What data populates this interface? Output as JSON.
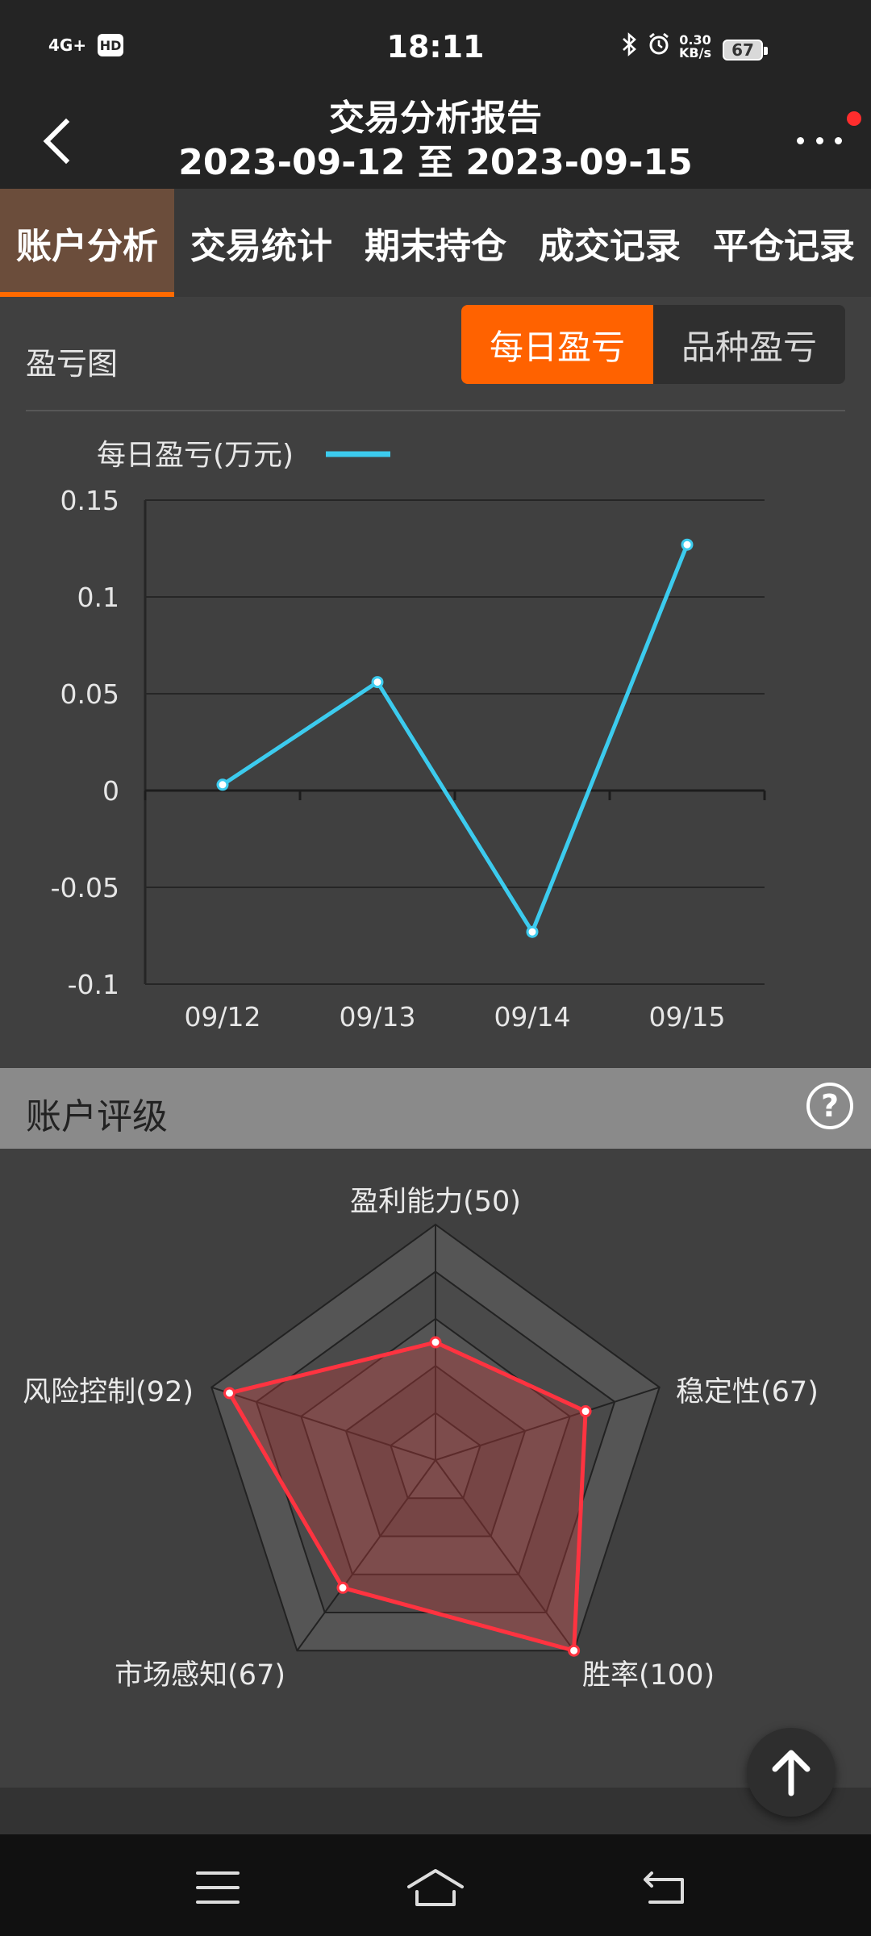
{
  "status_bar": {
    "network": "4G+",
    "hd": "HD",
    "time": "18:11",
    "speed_value": "0.30",
    "speed_unit": "KB/s",
    "battery": "67",
    "icons": [
      "bluetooth-icon",
      "alarm-icon"
    ]
  },
  "header": {
    "title": "交易分析报告",
    "date_range": "2023-09-12 至 2023-09-15"
  },
  "tabs": [
    {
      "label": "账户分析",
      "active": true
    },
    {
      "label": "交易统计",
      "active": false
    },
    {
      "label": "期末持仓",
      "active": false
    },
    {
      "label": "成交记录",
      "active": false
    },
    {
      "label": "平仓记录",
      "active": false
    }
  ],
  "pnl_section": {
    "label": "盈亏图",
    "toggle": [
      {
        "label": "每日盈亏",
        "active": true
      },
      {
        "label": "品种盈亏",
        "active": false
      }
    ]
  },
  "chart_data": {
    "type": "line",
    "categories": [
      "09/12",
      "09/13",
      "09/14",
      "09/15"
    ],
    "series": [
      {
        "name": "每日盈亏(万元)",
        "values": [
          0.003,
          0.056,
          -0.073,
          0.127
        ],
        "color": "#3ccbee"
      }
    ],
    "ylim": [
      -0.1,
      0.15
    ],
    "yticks": [
      {
        "value": 0.15,
        "label": "0.15"
      },
      {
        "value": 0.1,
        "label": "0.1"
      },
      {
        "value": 0.05,
        "label": "0.05"
      },
      {
        "value": 0,
        "label": "0"
      },
      {
        "value": -0.05,
        "label": "-0.05"
      },
      {
        "value": -0.1,
        "label": "-0.1"
      }
    ],
    "grid": true,
    "legend": "top-left"
  },
  "rating": {
    "title": "账户评级",
    "help_icon": "?",
    "axes": [
      {
        "name": "盈利能力",
        "value": 50,
        "label": "盈利能力(50)"
      },
      {
        "name": "稳定性",
        "value": 67,
        "label": "稳定性(67)"
      },
      {
        "name": "胜率",
        "value": 100,
        "label": "胜率(100)"
      },
      {
        "name": "市场感知",
        "value": 67,
        "label": "市场感知(67)"
      },
      {
        "name": "风险控制",
        "value": 92,
        "label": "风险控制(92)"
      }
    ],
    "max": 100,
    "line_color": "#ff3340"
  },
  "nav": {
    "icons": [
      "menu-icon",
      "home-icon",
      "back-icon"
    ]
  }
}
